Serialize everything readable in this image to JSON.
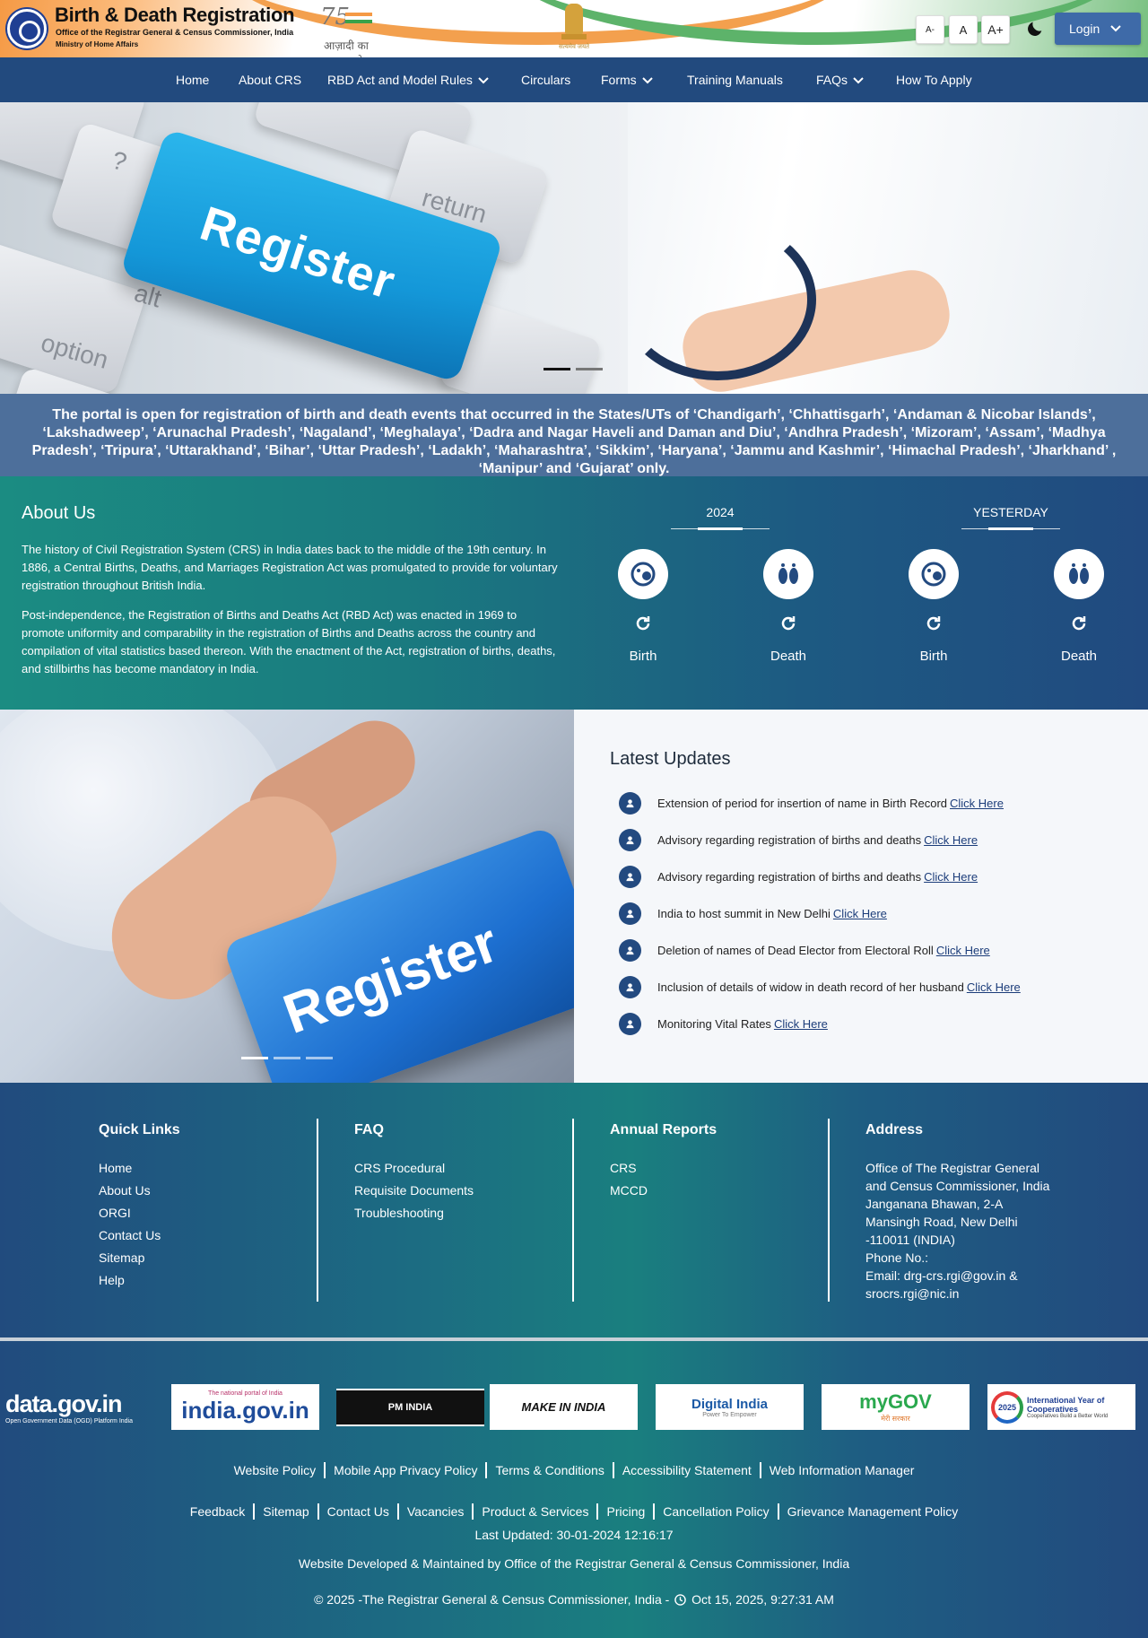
{
  "header": {
    "title": "Birth & Death Registration",
    "subtitle1": "Office of the Registrar General & Census Commissioner, India",
    "subtitle2": "Ministry of Home Affairs",
    "azadi_number": "75",
    "azadi_text": "आज़ादी का अमृत महोत्सव",
    "emblem_motto": "सत्यमेव जयते",
    "font_small": "A-",
    "font_normal": "A",
    "font_large": "A+",
    "login_label": "Login"
  },
  "nav": {
    "items": [
      {
        "label": "Home",
        "dropdown": false
      },
      {
        "label": "About CRS",
        "dropdown": false
      },
      {
        "label": "RBD Act and Model Rules",
        "dropdown": true
      },
      {
        "label": "Circulars",
        "dropdown": false
      },
      {
        "label": "Forms",
        "dropdown": true
      },
      {
        "label": "Training Manuals",
        "dropdown": false
      },
      {
        "label": "FAQs",
        "dropdown": true
      },
      {
        "label": "How To Apply",
        "dropdown": false
      }
    ]
  },
  "hero": {
    "key_text": "Register",
    "key_labels": [
      "return",
      "alt",
      "option",
      "?"
    ],
    "slide_count": 2,
    "active_slide": 0
  },
  "notice": "The portal is open for registration of birth and death events that occurred in the States/UTs of ‘Chandigarh’, ‘Chhattisgarh’, ‘Andaman & Nicobar Islands’, ‘Lakshadweep’, ‘Arunachal Pradesh’, ‘Nagaland’, ‘Meghalaya’, ‘Dadra and Nagar Haveli and Daman and Diu’, ‘Andhra Pradesh’, ‘Mizoram’, ‘Assam’, ‘Madhya Pradesh’, ‘Tripura’, ‘Uttarakhand’, ‘Bihar’, ‘Uttar Pradesh’, ‘Ladakh’, ‘Maharashtra’, ‘Sikkim’, ‘Haryana’, ‘Jammu and Kashmir’, ‘Himachal Pradesh’, ‘Jharkhand’ , ‘Manipur’ and ‘Gujarat’ only.",
  "about": {
    "title": "About Us",
    "p1": "The history of Civil Registration System (CRS) in India dates back to the middle of the 19th century. In 1886, a Central Births, Deaths, and Marriages Registration Act was promulgated to provide for voluntary registration throughout British India.",
    "p2": "Post-independence, the Registration of Births and Deaths Act (RBD Act) was enacted in 1969 to promote uniformity and comparability in the registration of Births and Deaths across the country and compilation of vital statistics based thereon. With the enactment of the Act, registration of births, deaths, and stillbirths has become mandatory in India."
  },
  "stats": {
    "period1": "2024",
    "period2": "YESTERDAY",
    "items": [
      {
        "label": "Birth",
        "icon": "baby-icon"
      },
      {
        "label": "Death",
        "icon": "footprint-icon"
      },
      {
        "label": "Birth",
        "icon": "baby-icon"
      },
      {
        "label": "Death",
        "icon": "footprint-icon"
      }
    ]
  },
  "updates": {
    "title": "Latest Updates",
    "link_label": "Click Here",
    "items": [
      "Extension of period for insertion of name in Birth Record",
      "Advisory regarding registration of births and deaths",
      "Advisory regarding registration of births and deaths",
      "India to host summit in New Delhi",
      "Deletion of names of Dead Elector from Electoral Roll",
      "Inclusion of details of widow in death record of her husband",
      "Monitoring Vital Rates"
    ],
    "image_text": "Register",
    "slide_count": 3,
    "active_slide": 0
  },
  "footer": {
    "quick_links": {
      "title": "Quick Links",
      "items": [
        "Home",
        "About Us",
        "ORGI",
        "Contact Us",
        "Sitemap",
        "Help"
      ]
    },
    "faq": {
      "title": "FAQ",
      "items": [
        "CRS Procedural",
        "Requisite Documents",
        "Troubleshooting"
      ]
    },
    "annual_reports": {
      "title": "Annual Reports",
      "items": [
        "CRS",
        "MCCD"
      ]
    },
    "address": {
      "title": "Address",
      "lines": [
        "Office of The Registrar General",
        "and Census Commissioner, India",
        "Janganana Bhawan, 2-A",
        "Mansingh Road, New Delhi",
        "-110011 (INDIA)",
        "Phone No.:",
        "Email: drg-crs.rgi@gov.in &",
        "srocrs.rgi@nic.in"
      ]
    },
    "partner_logos": [
      {
        "name": "data-gov-logo",
        "text": "data.gov.in",
        "sub": "Open Government Data (OGD) Platform India"
      },
      {
        "name": "india-gov-logo",
        "text": "india.gov.in",
        "sub": "The national portal of India"
      },
      {
        "name": "pm-india-logo",
        "text": "PM INDIA"
      },
      {
        "name": "make-in-india-logo",
        "text": "MAKE IN INDIA"
      },
      {
        "name": "digital-india-logo",
        "text": "Digital India",
        "sub": "Power To Empower"
      },
      {
        "name": "mygov-logo",
        "text": "myGOV",
        "sub": "मेरी सरकार"
      },
      {
        "name": "cooperatives-logo",
        "text": "International Year of Cooperatives",
        "sub": "Cooperatives Build a Better World",
        "year": "2025"
      }
    ],
    "policy_links_1": [
      "Website Policy",
      "Mobile App Privacy Policy",
      "Terms & Conditions",
      "Accessibility Statement",
      "Web Information Manager"
    ],
    "policy_links_2": [
      "Feedback",
      "Sitemap",
      "Contact Us",
      "Vacancies",
      "Product & Services",
      "Pricing",
      "Cancellation Policy",
      "Grievance Management Policy"
    ],
    "last_updated": "Last Updated: 30-01-2024 12:16:17",
    "developed_by": "Website Developed & Maintained by Office of the Registrar General & Census Commissioner, India",
    "copyright": "© 2025 -The Registrar General & Census Commissioner, India -",
    "datetime": "Oct 15, 2025, 9:27:31 AM"
  },
  "colors": {
    "nav_bg": "#224a7e",
    "notice_bg": "#4d6f9b",
    "icon_bg": "#234a80",
    "link": "#1c3d7a"
  }
}
